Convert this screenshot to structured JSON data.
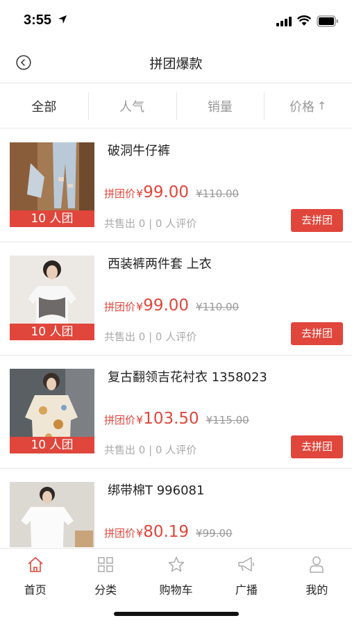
{
  "status_bar": {
    "time": "3:55"
  },
  "header": {
    "title": "拼团爆款"
  },
  "sort_tabs": [
    {
      "label": "全部"
    },
    {
      "label": "人气"
    },
    {
      "label": "销量"
    },
    {
      "label": "价格"
    }
  ],
  "products": [
    {
      "name": "破洞牛仔裤",
      "badge": "10 人团",
      "price_label": "拼团价",
      "currency": "¥",
      "price": "99.00",
      "old_price": "¥110.00",
      "sales": "共售出 0 | 0 人评价",
      "button": "去拼团"
    },
    {
      "name": "西装裤两件套 上衣",
      "badge": "10 人团",
      "price_label": "拼团价",
      "currency": "¥",
      "price": "99.00",
      "old_price": "¥110.00",
      "sales": "共售出 0 | 0 人评价",
      "button": "去拼团"
    },
    {
      "name": "复古翻领吉花衬衣 1358023",
      "badge": "10 人团",
      "price_label": "拼团价",
      "currency": "¥",
      "price": "103.50",
      "old_price": "¥115.00",
      "sales": "共售出 0 | 0 人评价",
      "button": "去拼团"
    },
    {
      "name": "绑带棉T 996081",
      "price_label": "拼团价",
      "currency": "¥",
      "price": "80.19",
      "old_price": "¥99.00"
    }
  ],
  "bottom_nav": [
    {
      "label": "首页",
      "icon": "home-icon"
    },
    {
      "label": "分类",
      "icon": "category-icon"
    },
    {
      "label": "购物车",
      "icon": "star-icon"
    },
    {
      "label": "广播",
      "icon": "megaphone-icon"
    },
    {
      "label": "我的",
      "icon": "user-icon"
    }
  ],
  "colors": {
    "accent": "#e0463b",
    "home_active": "#e0463b"
  }
}
